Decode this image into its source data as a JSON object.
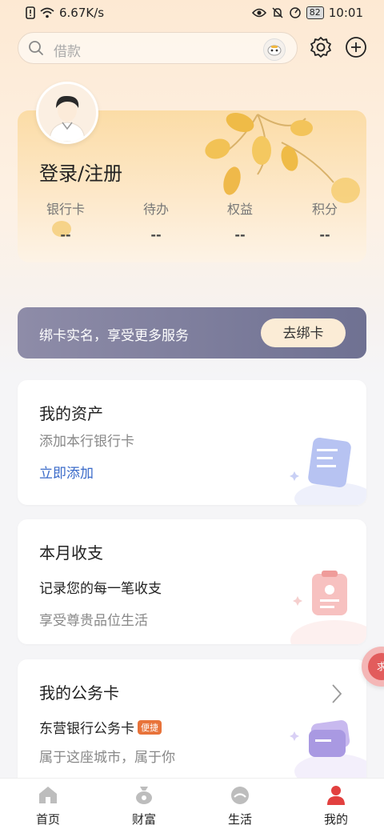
{
  "status_bar": {
    "speed": "6.67K/s",
    "battery": "82",
    "time": "10:01"
  },
  "search": {
    "placeholder": "借款"
  },
  "profile": {
    "login_label": "登录/注册",
    "stats": [
      {
        "label": "银行卡",
        "value": "--"
      },
      {
        "label": "待办",
        "value": "--"
      },
      {
        "label": "权益",
        "value": "--"
      },
      {
        "label": "积分",
        "value": "--"
      }
    ]
  },
  "bind_banner": {
    "text": "绑卡实名，享受更多服务",
    "button": "去绑卡"
  },
  "assets_card": {
    "title": "我的资产",
    "subtitle": "添加本行银行卡",
    "link": "立即添加"
  },
  "monthly_card": {
    "title": "本月收支",
    "text": "记录您的每一笔收支",
    "subtitle": "享受尊贵品位生活"
  },
  "business_card": {
    "title": "我的公务卡",
    "text": "东营银行公务卡",
    "badge": "便捷",
    "subtitle": "属于这座城市，属于你"
  },
  "help": {
    "label": "求"
  },
  "bottom_nav": [
    {
      "label": "首页",
      "icon": "home-icon"
    },
    {
      "label": "财富",
      "icon": "wealth-bag-icon"
    },
    {
      "label": "生活",
      "icon": "life-icon"
    },
    {
      "label": "我的",
      "icon": "profile-icon"
    }
  ],
  "colors": {
    "accent_blue": "#3b6bc9",
    "active_red": "#e2403f",
    "banner": "#7b7d9b",
    "badge": "#e8733a"
  }
}
